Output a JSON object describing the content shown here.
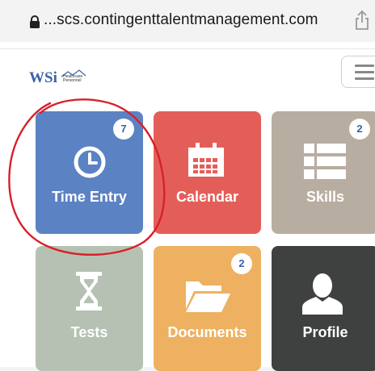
{
  "browser": {
    "url": "...scs.contingenttalentmanagement.com"
  },
  "header": {
    "logo_text": "WSi",
    "logo_small_text": "Healthcare Personnel"
  },
  "tiles": [
    {
      "label": "Time Entry",
      "badge": "7",
      "color": "#5b82c3",
      "icon": "clock-icon"
    },
    {
      "label": "Calendar",
      "badge": "",
      "color": "#e45e59",
      "icon": "calendar-icon"
    },
    {
      "label": "Skills",
      "badge": "2",
      "color": "#b8ada1",
      "icon": "list-icon"
    },
    {
      "label": "Tests",
      "badge": "",
      "color": "#b6c1b3",
      "icon": "hourglass-icon"
    },
    {
      "label": "Documents",
      "badge": "2",
      "color": "#eeb161",
      "icon": "folder-icon"
    },
    {
      "label": "Profile",
      "badge": "",
      "color": "#3f4040",
      "icon": "user-icon"
    }
  ],
  "annotation": {
    "color": "#d8202a"
  }
}
